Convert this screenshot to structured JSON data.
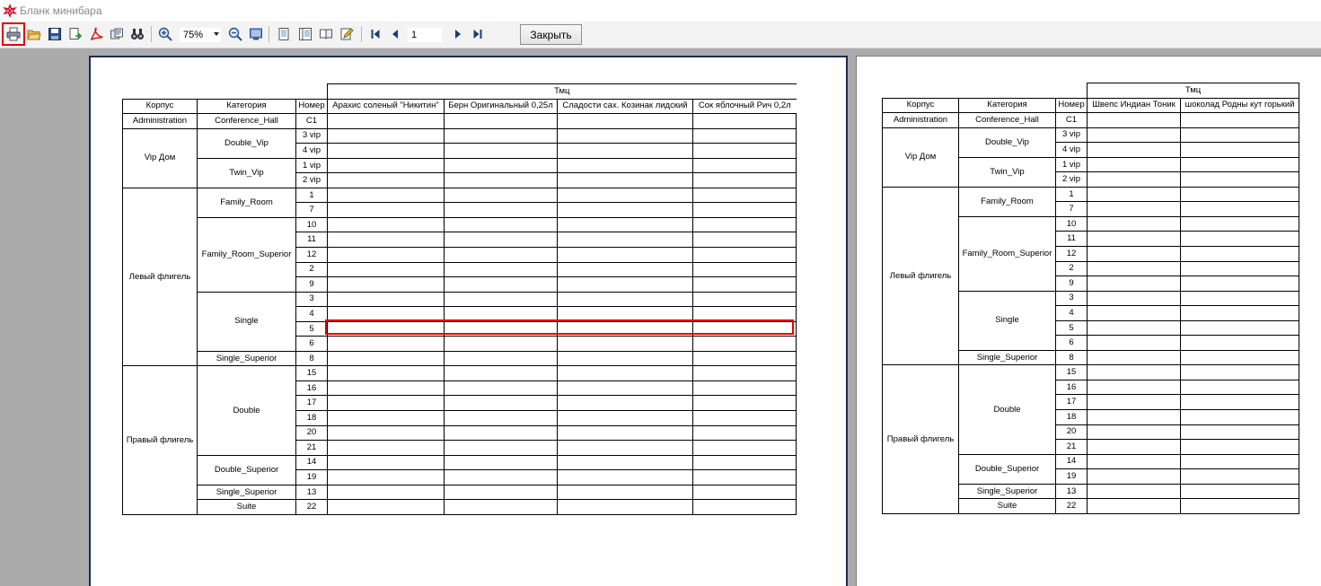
{
  "window": {
    "title": "Бланк минибара"
  },
  "toolbar": {
    "buttons": [
      {
        "name": "print-button",
        "icon": "printer-icon",
        "selected": true
      },
      {
        "name": "open-button",
        "icon": "folder-open-icon"
      },
      {
        "name": "save-button",
        "icon": "floppy-disk-icon"
      },
      {
        "name": "export-button",
        "icon": "export-icon"
      },
      {
        "name": "export-pdf-button",
        "icon": "pdf-icon"
      },
      {
        "name": "send-email-button",
        "icon": "email-icon"
      },
      {
        "name": "find-button",
        "icon": "binoculars-icon"
      },
      {
        "name": "zoom-in-button",
        "icon": "zoom-in-icon"
      },
      {
        "name": "zoom-out-button",
        "icon": "zoom-out-icon"
      },
      {
        "name": "full-screen-button",
        "icon": "monitor-icon"
      },
      {
        "name": "page-setup-button",
        "icon": "page-icon"
      },
      {
        "name": "outline-button",
        "icon": "outline-icon"
      },
      {
        "name": "thumbnails-button",
        "icon": "book-icon"
      },
      {
        "name": "edit-button",
        "icon": "edit-icon"
      },
      {
        "name": "first-page-button",
        "icon": "first-page-icon"
      },
      {
        "name": "prev-page-button",
        "icon": "prev-page-icon"
      },
      {
        "name": "next-page-button",
        "icon": "next-page-icon"
      },
      {
        "name": "last-page-button",
        "icon": "last-page-icon"
      }
    ],
    "zoom": "75%",
    "page_number": "1",
    "close_label": "Закрыть"
  },
  "colors": {
    "selection": "#e00000",
    "page_border": "#1f2a55"
  },
  "report": {
    "header_group": "Тмц",
    "col_korpus": "Корпус",
    "col_category": "Категория",
    "col_number": "Номер",
    "page1_products": [
      "Арахис соленый \"Никитин\"",
      "Берн Оригинальный 0,25л",
      "Сладости сах. Козинак лидский",
      "Сок яблочный Рич  0,2л"
    ],
    "page2_products": [
      "Швепс Индиан Тоник",
      "шоколад Родны кут горький"
    ],
    "rows": [
      {
        "korpus": "Administration",
        "category": "Conference_Hall",
        "number": "C1"
      },
      {
        "korpus": "Vip Дом",
        "category": "Double_Vip",
        "number": "3 vip"
      },
      {
        "korpus": "",
        "category": "",
        "number": "4 vip"
      },
      {
        "korpus": "",
        "category": "Twin_Vip",
        "number": "1 vip"
      },
      {
        "korpus": "",
        "category": "",
        "number": "2 vip"
      },
      {
        "korpus": "Левый флигель",
        "category": "Family_Room",
        "number": "1"
      },
      {
        "korpus": "",
        "category": "",
        "number": "7"
      },
      {
        "korpus": "",
        "category": "Family_Room_Superior",
        "number": "10"
      },
      {
        "korpus": "",
        "category": "",
        "number": "11"
      },
      {
        "korpus": "",
        "category": "",
        "number": "12"
      },
      {
        "korpus": "",
        "category": "",
        "number": "2"
      },
      {
        "korpus": "",
        "category": "",
        "number": "9"
      },
      {
        "korpus": "",
        "category": "Single",
        "number": "3"
      },
      {
        "korpus": "",
        "category": "",
        "number": "4"
      },
      {
        "korpus": "",
        "category": "",
        "number": "5"
      },
      {
        "korpus": "",
        "category": "",
        "number": "6"
      },
      {
        "korpus": "",
        "category": "Single_Superior",
        "number": "8"
      },
      {
        "korpus": "Правый флигель",
        "category": "Double",
        "number": "15"
      },
      {
        "korpus": "",
        "category": "",
        "number": "16"
      },
      {
        "korpus": "",
        "category": "",
        "number": "17"
      },
      {
        "korpus": "",
        "category": "",
        "number": "18"
      },
      {
        "korpus": "",
        "category": "",
        "number": "20"
      },
      {
        "korpus": "",
        "category": "",
        "number": "21"
      },
      {
        "korpus": "",
        "category": "Double_Superior",
        "number": "14"
      },
      {
        "korpus": "",
        "category": "",
        "number": "19"
      },
      {
        "korpus": "",
        "category": "Single_Superior",
        "number": "13"
      },
      {
        "korpus": "",
        "category": "Suite",
        "number": "22"
      }
    ],
    "korpus_spans": [
      1,
      4,
      12,
      10
    ],
    "category_spans": [
      1,
      2,
      2,
      2,
      5,
      4,
      1,
      6,
      2,
      1,
      1
    ],
    "selected_row_index": 14
  }
}
